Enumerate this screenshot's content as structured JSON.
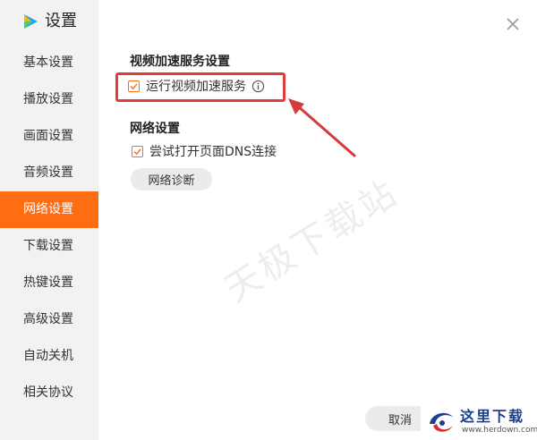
{
  "app": {
    "title": "设置"
  },
  "sidebar": {
    "items": [
      {
        "label": "基本设置"
      },
      {
        "label": "播放设置"
      },
      {
        "label": "画面设置"
      },
      {
        "label": "音频设置"
      },
      {
        "label": "网络设置",
        "active": true
      },
      {
        "label": "下载设置"
      },
      {
        "label": "热键设置"
      },
      {
        "label": "高级设置"
      },
      {
        "label": "自动关机"
      },
      {
        "label": "相关协议"
      }
    ]
  },
  "video_accel": {
    "title": "视频加速服务设置",
    "option_label": "运行视频加速服务",
    "checked": true
  },
  "network": {
    "title": "网络设置",
    "option_label": "尝试打开页面DNS连接",
    "checked": true,
    "diagnose_button": "网络诊断"
  },
  "footer": {
    "cancel_label": "取消"
  },
  "watermark": {
    "text": "天极下载站"
  },
  "site_logo": {
    "cn_text": "这里下载",
    "en_text": "www.herdown.com"
  },
  "colors": {
    "accent": "#ff6d13",
    "highlight": "#e23b3b",
    "sidebar_bg": "#f2f2f2"
  },
  "icons": {
    "close": "close-icon",
    "info": "info-icon",
    "check": "check-icon"
  }
}
